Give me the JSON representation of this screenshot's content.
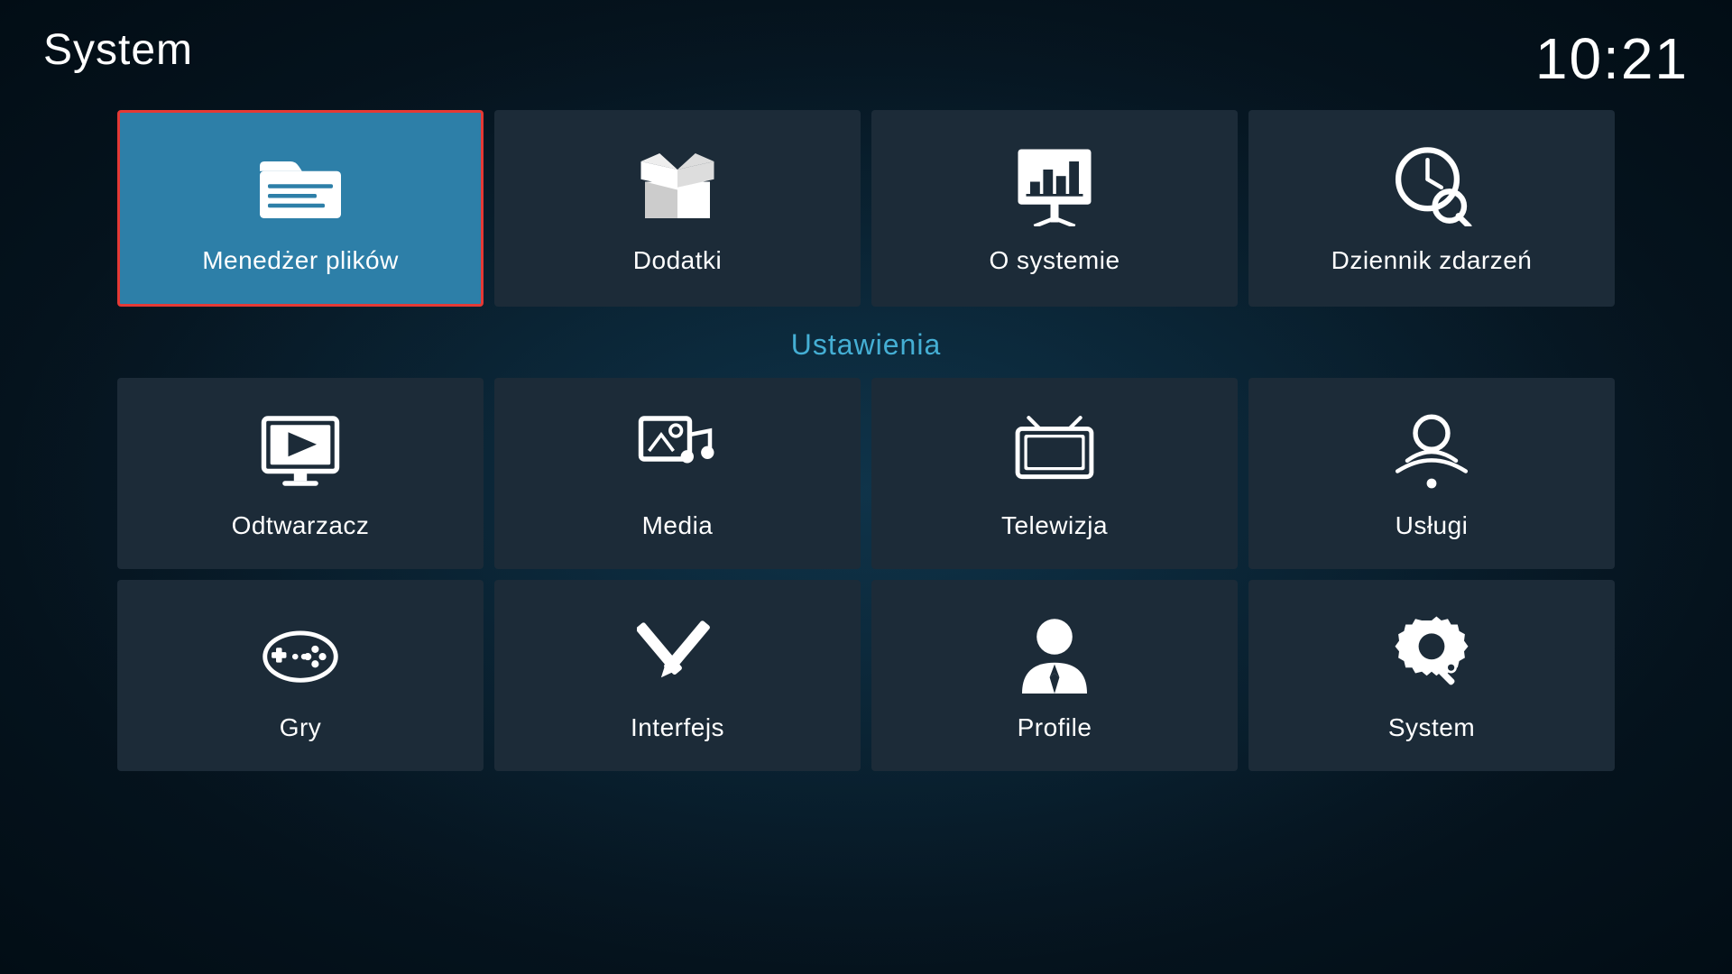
{
  "header": {
    "title": "System",
    "clock": "10:21"
  },
  "top_row": [
    {
      "id": "file-manager",
      "label": "Menedżer plików",
      "active": true
    },
    {
      "id": "addons",
      "label": "Dodatki",
      "active": false
    },
    {
      "id": "about",
      "label": "O systemie",
      "active": false
    },
    {
      "id": "event-log",
      "label": "Dziennik zdarzeń",
      "active": false
    }
  ],
  "section_label": "Ustawienia",
  "settings_row1": [
    {
      "id": "player",
      "label": "Odtwarzacz",
      "active": false
    },
    {
      "id": "media",
      "label": "Media",
      "active": false
    },
    {
      "id": "tv",
      "label": "Telewizja",
      "active": false
    },
    {
      "id": "services",
      "label": "Usługi",
      "active": false
    }
  ],
  "settings_row2": [
    {
      "id": "games",
      "label": "Gry",
      "active": false
    },
    {
      "id": "interface",
      "label": "Interfejs",
      "active": false
    },
    {
      "id": "profiles",
      "label": "Profile",
      "active": false
    },
    {
      "id": "system",
      "label": "System",
      "active": false
    }
  ]
}
